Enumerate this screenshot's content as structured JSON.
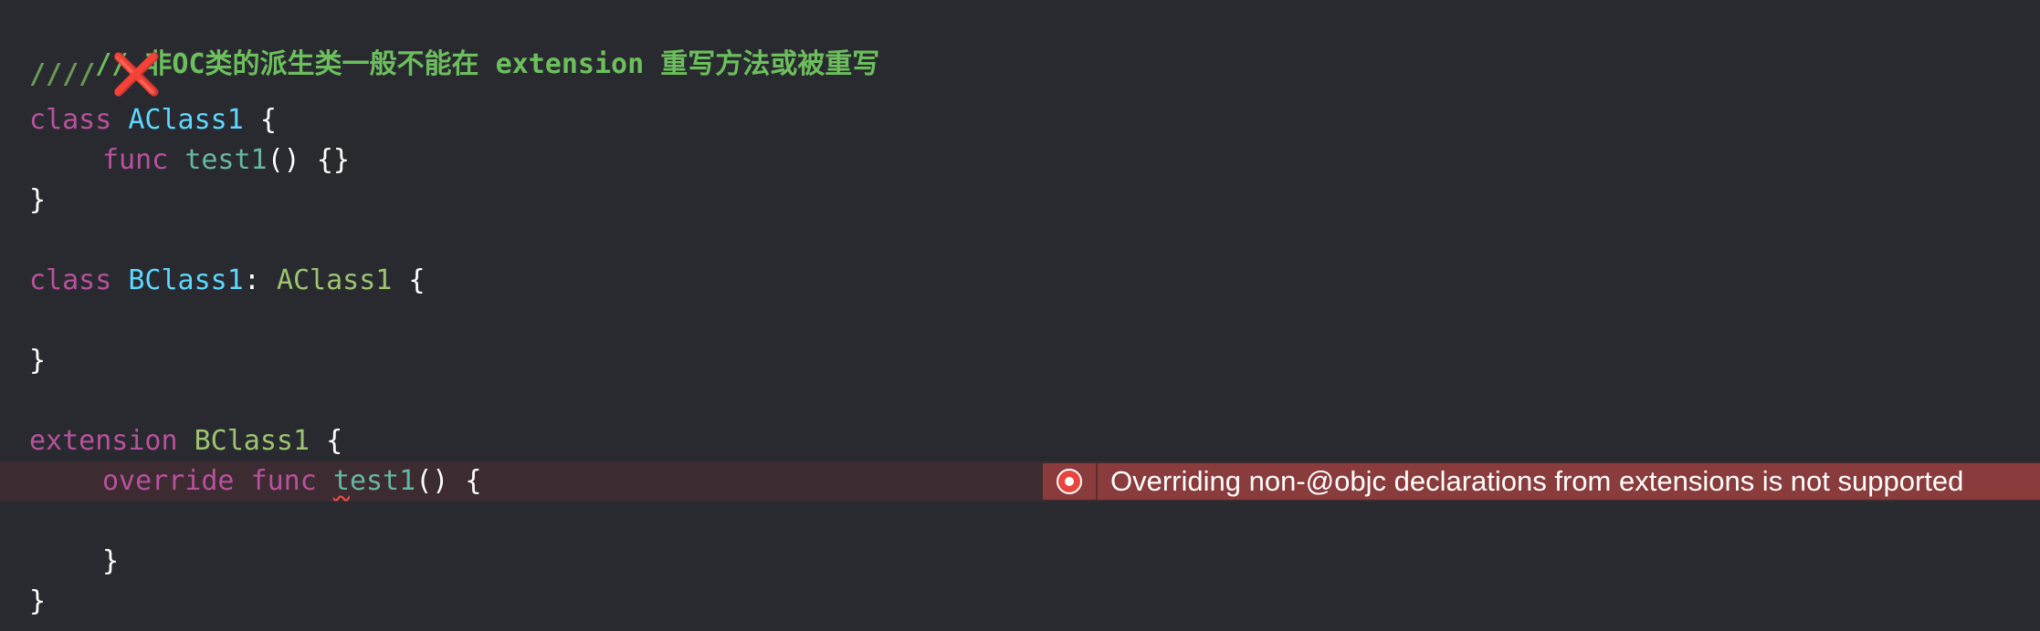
{
  "code": {
    "comment_line": "// 非OC类的派生类一般不能在 extension 重写方法或被重写",
    "marker_slashes": "////",
    "marker_symbol": "❌",
    "kw_class": "class",
    "kw_func": "func",
    "kw_extension": "extension",
    "kw_override": "override",
    "aclass_name": "AClass1",
    "bclass_name": "BClass1",
    "superclass_ref": "AClass1",
    "extension_target": "BClass1",
    "method_name": "test1",
    "method_first_char": "t",
    "method_rest": "est1",
    "parens": "()",
    "empty_body": "{}",
    "open_brace": "{",
    "close_brace": "}",
    "colon": ":"
  },
  "error": {
    "message": "Overriding non-@objc declarations from extensions is not supported",
    "icon": "error-stop-icon",
    "color": "#8a3b3b"
  }
}
